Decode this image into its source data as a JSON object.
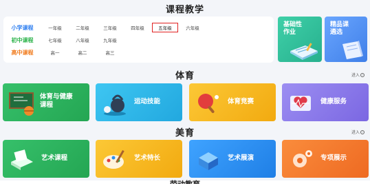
{
  "sections": {
    "teaching_title": "课程教学",
    "pe_title": "体育",
    "arts_title": "美育",
    "more_label": "进入",
    "next_title": "劳动教育"
  },
  "levels": [
    {
      "label": "小学课程",
      "color": "#2f7ff0",
      "grades": [
        "一年级",
        "二年级",
        "三年级",
        "四年级",
        "五年级",
        "六年级"
      ],
      "selected": "五年级"
    },
    {
      "label": "初中课程",
      "color": "#2cb34a",
      "grades": [
        "七年级",
        "八年级",
        "九年级"
      ]
    },
    {
      "label": "高中课程",
      "color": "#f07a1c",
      "grades": [
        "高一",
        "高二",
        "高三"
      ]
    }
  ],
  "side_cards": [
    {
      "label_line1": "基础性",
      "label_line2": "作业",
      "color": "#35c6a0"
    },
    {
      "label_line1": "精品课",
      "label_line2": "遴选",
      "color": "#4b8cf0"
    }
  ],
  "pe_cards": [
    {
      "line1": "体育与健康",
      "line2": "课程",
      "color": "#2db35d"
    },
    {
      "line1": "运动技能",
      "line2": "",
      "color": "#2bb3e8"
    },
    {
      "line1": "体育竞赛",
      "line2": "",
      "color": "#f4b81c"
    },
    {
      "line1": "健康服务",
      "line2": "",
      "color": "#8a78ea"
    }
  ],
  "arts_cards": [
    {
      "line1": "艺术课程",
      "line2": "",
      "color": "#2db35d"
    },
    {
      "line1": "艺术特长",
      "line2": "",
      "color": "#f2b21a"
    },
    {
      "line1": "艺术展演",
      "line2": "",
      "color": "#2b8ff0"
    },
    {
      "line1": "专项展示",
      "line2": "",
      "color": "#f07a30"
    }
  ]
}
